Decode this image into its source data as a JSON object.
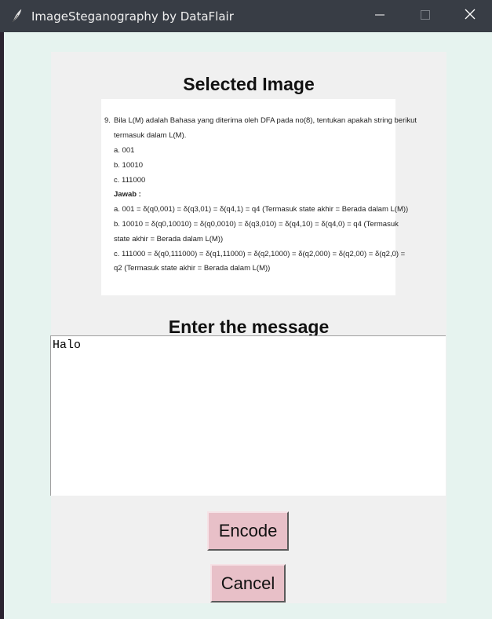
{
  "window": {
    "title": "ImageSteganography by DataFlair",
    "icon": "feather-icon",
    "controls": [
      "minimize-icon",
      "maximize-icon",
      "close-icon"
    ]
  },
  "selected_image": {
    "heading": "Selected Image",
    "document": {
      "number": "9.",
      "lines": [
        "Bila L(M) adalah Bahasa yang diterima oleh DFA pada no(8), tentukan apakah string berikut",
        "termasuk dalam L(M).",
        "a. 001",
        "b. 10010",
        "c. 111000",
        "Jawab :",
        "a. 001 = δ(q0,001) =  δ(q3,01) =  δ(q4,1) = q4 (Termasuk state akhir = Berada dalam L(M))",
        "b. 10010 = δ(q0,10010) =  δ(q0,0010) =  δ(q3,010) =  δ(q4,10) =  δ(q4,0) = q4 (Termasuk",
        "state akhir = Berada dalam L(M))",
        "c. 111000 = δ(q0,111000) =  δ(q1,11000) =  δ(q2,1000) =  δ(q2,000) =  δ(q2,00) =  δ(q2,0) =",
        "q2 (Termasuk state akhir = Berada dalam L(M))"
      ]
    }
  },
  "message": {
    "heading": "Enter the message",
    "value": "Halo"
  },
  "buttons": {
    "encode": "Encode",
    "cancel": "Cancel"
  },
  "colors": {
    "titlebar": "#383d45",
    "window_bg": "#e6f3ef",
    "panel_bg": "#f0f0f0",
    "button_bg": "#e8c0c8"
  }
}
